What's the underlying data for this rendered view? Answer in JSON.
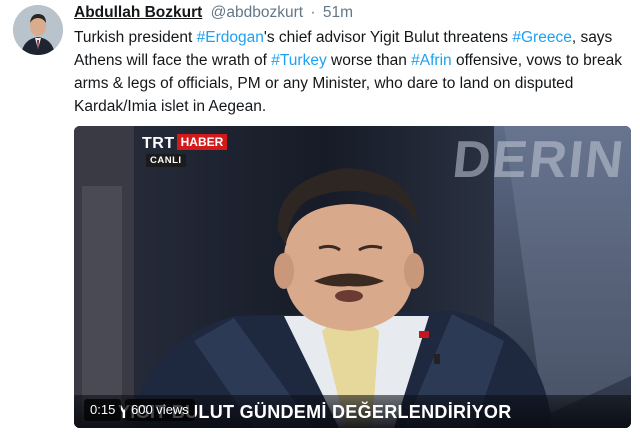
{
  "author": {
    "name": "Abdullah Bozkurt",
    "handle": "@abdbozkurt",
    "separator": "·",
    "time": "51m"
  },
  "tweet": {
    "t1": "Turkish president ",
    "h1": "#Erdogan",
    "t2": "'s chief advisor Yigit Bulut threatens ",
    "h2": "#Greece",
    "t3": ", says Athens will face the wrath of ",
    "h3": "#Turkey",
    "t4": " worse than ",
    "h4": "#Afrin",
    "t5": " offensive, vows to break arms & legs of officials, PM or any Minister, who dare to land on disputed Kardak/Imia islet in Aegean."
  },
  "video": {
    "logo_trt": "TRT",
    "logo_haber": "HABER",
    "logo_live": "CANLI",
    "background_word": "DERIN",
    "lower_third": "YIGIT BULUT GÜNDEMİ DEĞERLENDİRİYOR",
    "duration": "0:15",
    "views": "600 views"
  },
  "colors": {
    "link": "#1da1f2",
    "text": "#14171a",
    "muted": "#657786",
    "brand_red": "#d21a1a"
  }
}
